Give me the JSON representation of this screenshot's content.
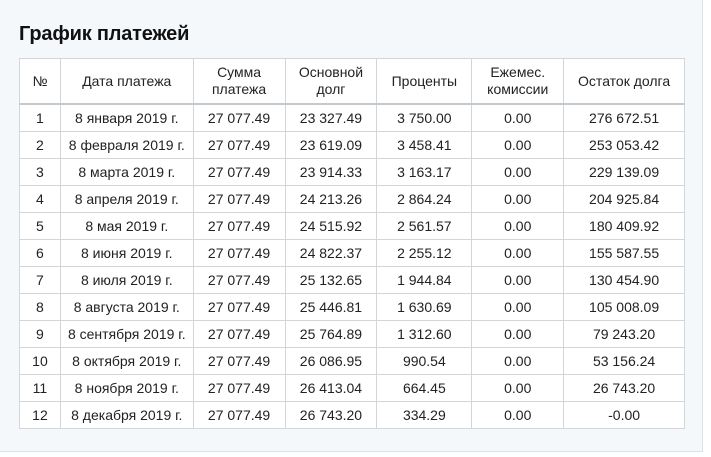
{
  "title": "График платежей",
  "headers": {
    "num": "№",
    "date": "Дата платежа",
    "sum_line1": "Сумма",
    "sum_line2": "платежа",
    "main_line1": "Основной",
    "main_line2": "долг",
    "pct": "Проценты",
    "fee_line1": "Ежемес.",
    "fee_line2": "комиссии",
    "rest": "Остаток долга"
  },
  "rows": [
    {
      "num": "1",
      "date": "8 января 2019 г.",
      "sum": "27 077.49",
      "main": "23 327.49",
      "pct": "3 750.00",
      "fee": "0.00",
      "rest": "276 672.51"
    },
    {
      "num": "2",
      "date": "8 февраля 2019 г.",
      "sum": "27 077.49",
      "main": "23 619.09",
      "pct": "3 458.41",
      "fee": "0.00",
      "rest": "253 053.42"
    },
    {
      "num": "3",
      "date": "8 марта 2019 г.",
      "sum": "27 077.49",
      "main": "23 914.33",
      "pct": "3 163.17",
      "fee": "0.00",
      "rest": "229 139.09"
    },
    {
      "num": "4",
      "date": "8 апреля 2019 г.",
      "sum": "27 077.49",
      "main": "24 213.26",
      "pct": "2 864.24",
      "fee": "0.00",
      "rest": "204 925.84"
    },
    {
      "num": "5",
      "date": "8 мая 2019 г.",
      "sum": "27 077.49",
      "main": "24 515.92",
      "pct": "2 561.57",
      "fee": "0.00",
      "rest": "180 409.92"
    },
    {
      "num": "6",
      "date": "8 июня 2019 г.",
      "sum": "27 077.49",
      "main": "24 822.37",
      "pct": "2 255.12",
      "fee": "0.00",
      "rest": "155 587.55"
    },
    {
      "num": "7",
      "date": "8 июля 2019 г.",
      "sum": "27 077.49",
      "main": "25 132.65",
      "pct": "1 944.84",
      "fee": "0.00",
      "rest": "130 454.90"
    },
    {
      "num": "8",
      "date": "8 августа 2019 г.",
      "sum": "27 077.49",
      "main": "25 446.81",
      "pct": "1 630.69",
      "fee": "0.00",
      "rest": "105 008.09"
    },
    {
      "num": "9",
      "date": "8 сентября 2019 г.",
      "sum": "27 077.49",
      "main": "25 764.89",
      "pct": "1 312.60",
      "fee": "0.00",
      "rest": "79 243.20"
    },
    {
      "num": "10",
      "date": "8 октября 2019 г.",
      "sum": "27 077.49",
      "main": "26 086.95",
      "pct": "990.54",
      "fee": "0.00",
      "rest": "53 156.24"
    },
    {
      "num": "11",
      "date": "8 ноября 2019 г.",
      "sum": "27 077.49",
      "main": "26 413.04",
      "pct": "664.45",
      "fee": "0.00",
      "rest": "26 743.20"
    },
    {
      "num": "12",
      "date": "8 декабря 2019 г.",
      "sum": "27 077.49",
      "main": "26 743.20",
      "pct": "334.29",
      "fee": "0.00",
      "rest": "-0.00"
    }
  ]
}
